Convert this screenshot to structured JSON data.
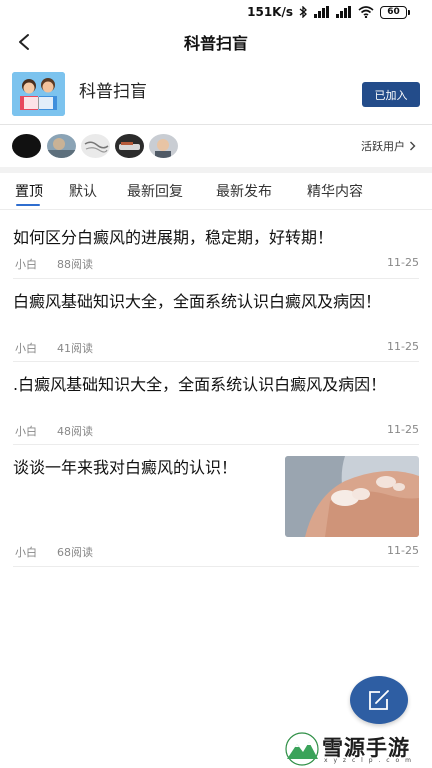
{
  "status_bar": {
    "speed": "151K/s",
    "battery": "60"
  },
  "nav": {
    "title": "科普扫盲"
  },
  "group": {
    "name": "科普扫盲",
    "join_label": "已加入"
  },
  "active_users": {
    "label": "活跃用户"
  },
  "tabs": [
    {
      "label": "置顶",
      "active": true
    },
    {
      "label": "默认",
      "active": false
    },
    {
      "label": "最新回复",
      "active": false
    },
    {
      "label": "最新发布",
      "active": false
    },
    {
      "label": "精华内容",
      "active": false
    }
  ],
  "posts": [
    {
      "title": "如何区分白癜风的进展期，稳定期，好转期！",
      "author": "小白",
      "reads": "88阅读",
      "date": "11-25"
    },
    {
      "title": "白癜风基础知识大全，全面系统认识白癜风及病因！",
      "author": "小白",
      "reads": "41阅读",
      "date": "11-25"
    },
    {
      "title": ".白癜风基础知识大全，全面系统认识白癜风及病因！",
      "author": "小白",
      "reads": "48阅读",
      "date": "11-25"
    },
    {
      "title": "谈谈一年来我对白癜风的认识！",
      "author": "小白",
      "reads": "68阅读",
      "date": "11-25"
    }
  ],
  "watermark": {
    "text": "雪源手游网",
    "sub": "x y z c l p . c o m"
  },
  "colors": {
    "accent": "#234c8a",
    "tab_underline": "#2f6ecf",
    "fab": "#2e5ea3"
  }
}
